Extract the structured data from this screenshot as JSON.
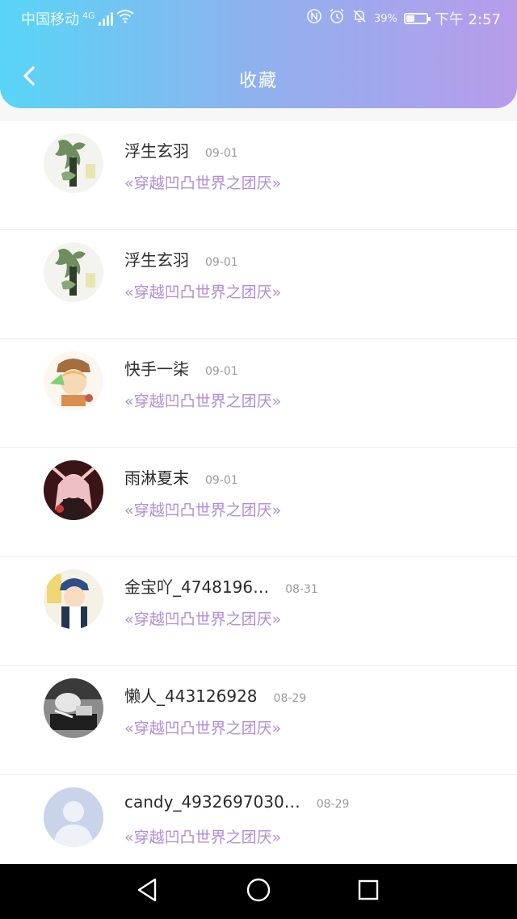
{
  "status_bar": {
    "carrier": "中国移动",
    "network": "4G",
    "battery_pct": "39%",
    "time": "下午 2:57"
  },
  "header": {
    "title": "收藏",
    "back_icon": "chevron-left-icon"
  },
  "items": [
    {
      "name": "浮生玄羽",
      "date": "09-01",
      "subject": "«穿越凹凸世界之团厌»"
    },
    {
      "name": "浮生玄羽",
      "date": "09-01",
      "subject": "«穿越凹凸世界之团厌»"
    },
    {
      "name": "快手一柒",
      "date": "09-01",
      "subject": "«穿越凹凸世界之团厌»"
    },
    {
      "name": "雨淋夏末",
      "date": "09-01",
      "subject": "«穿越凹凸世界之团厌»"
    },
    {
      "name": "金宝吖_4748196…",
      "date": "08-31",
      "subject": "«穿越凹凸世界之团厌»"
    },
    {
      "name": "懒人_443126928",
      "date": "08-29",
      "subject": "«穿越凹凸世界之团厌»"
    },
    {
      "name": "candy_4932697030…",
      "date": "08-29",
      "subject": "«穿越凹凸世界之团厌»"
    }
  ],
  "colors": {
    "header_start": "#58d5f6",
    "header_end": "#b89cec",
    "subject": "#b18ed6",
    "navbar": "#000000"
  },
  "system_nav": {
    "back": "triangle-back-icon",
    "home": "circle-home-icon",
    "recents": "square-recents-icon"
  }
}
